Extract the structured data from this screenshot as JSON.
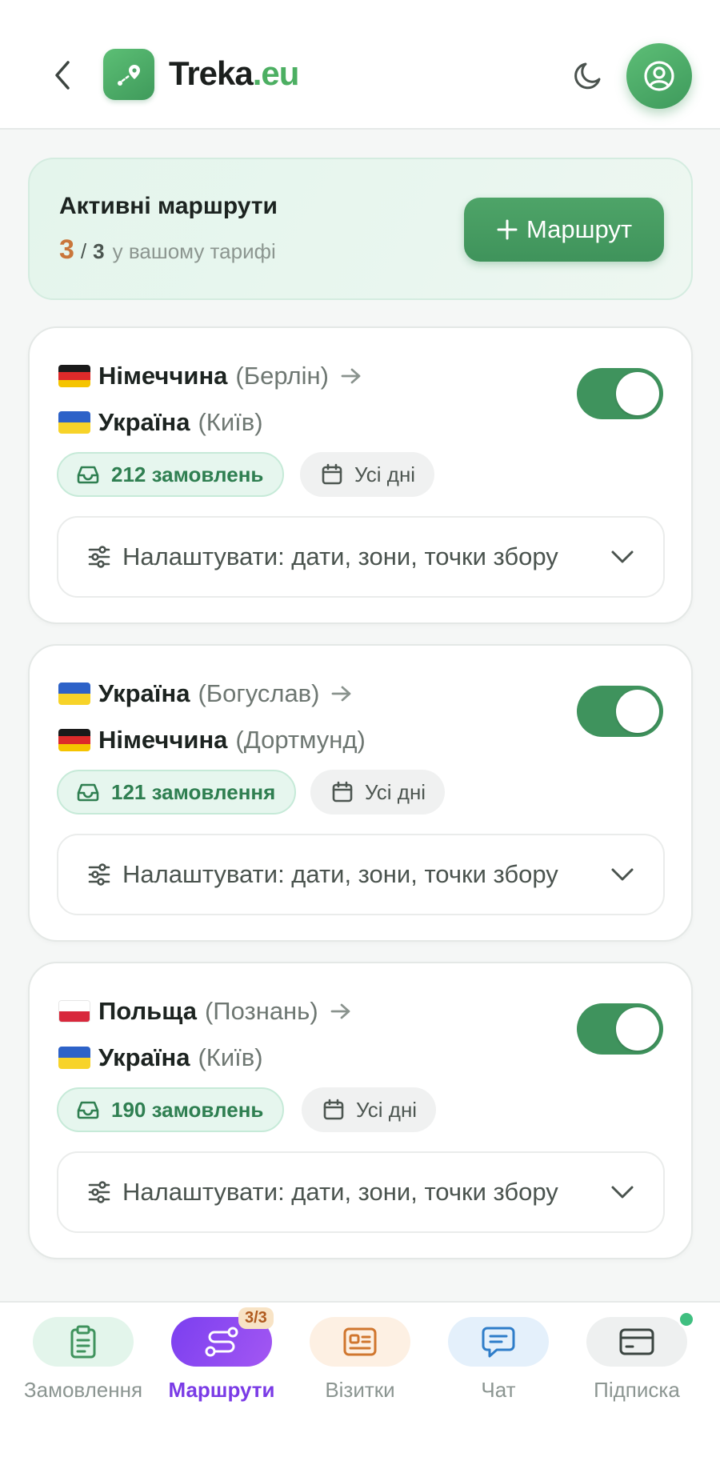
{
  "header": {
    "brand_name": "Treka",
    "brand_tld": ".eu"
  },
  "summary": {
    "title": "Активні маршрути",
    "current": "3",
    "separator": "/",
    "total": "3",
    "suffix": "у вашому тарифі",
    "add_button": "Маршрут"
  },
  "routes": [
    {
      "from_country": "Німеччина",
      "from_city": "(Берлін)",
      "from_flag": "de",
      "to_country": "Україна",
      "to_city": "(Київ)",
      "to_flag": "ua",
      "orders": "212 замовлень",
      "days": "Усі дні",
      "enabled": true,
      "settings": "Налаштувати: дати, зони, точки збору"
    },
    {
      "from_country": "Україна",
      "from_city": "(Богуслав)",
      "from_flag": "ua",
      "to_country": "Німеччина",
      "to_city": "(Дортмунд)",
      "to_flag": "de",
      "orders": "121 замовлення",
      "days": "Усі дні",
      "enabled": true,
      "settings": "Налаштувати: дати, зони, точки збору"
    },
    {
      "from_country": "Польща",
      "from_city": "(Познань)",
      "from_flag": "pl",
      "to_country": "Україна",
      "to_city": "(Київ)",
      "to_flag": "ua",
      "orders": "190 замовлень",
      "days": "Усі дні",
      "enabled": true,
      "settings": "Налаштувати: дати, зони, точки збору"
    }
  ],
  "nav": {
    "orders": "Замовлення",
    "routes": "Маршрути",
    "routes_counter": "3/3",
    "cards": "Візитки",
    "chat": "Чат",
    "subscription": "Підписка"
  },
  "colors": {
    "brand_green": "#4caf62",
    "toggle_on": "#3f935d",
    "active_nav": "#7a3be6",
    "count_accent": "#c9763a"
  }
}
